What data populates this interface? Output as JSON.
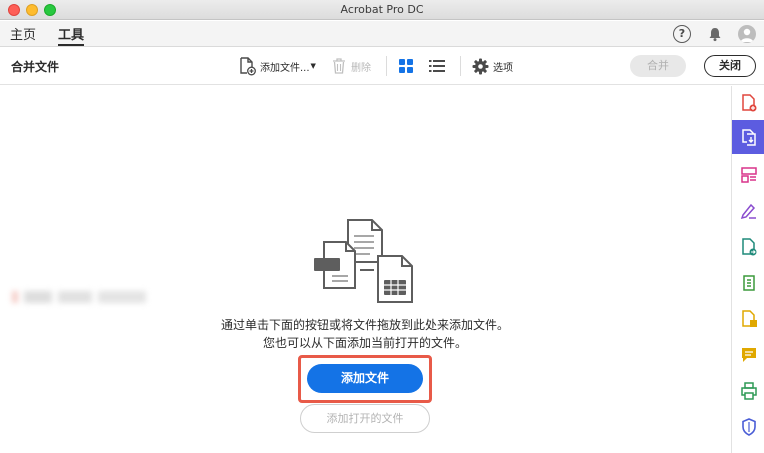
{
  "window": {
    "title": "Acrobat Pro DC"
  },
  "tabs": {
    "home": "主页",
    "tools": "工具"
  },
  "header_icons": {
    "help": "?"
  },
  "toolbar": {
    "title": "合并文件",
    "add_files": "添加文件...",
    "delete": "删除",
    "options": "选项",
    "merge": "合并",
    "close": "关闭"
  },
  "main": {
    "message_line1": "通过单击下面的按钮或将文件拖放到此处来添加文件。",
    "message_line2": "您也可以从下面添加当前打开的文件。",
    "add_files_button": "添加文件",
    "add_open_files_button": "添加打开的文件"
  },
  "right_rail": {
    "items": [
      "create-pdf-icon",
      "combine-files-icon",
      "organize-pages-icon",
      "fill-sign-icon",
      "export-pdf-icon",
      "compress-pdf-icon",
      "edit-pdf-icon",
      "comment-icon",
      "print-production-icon",
      "protect-icon"
    ],
    "active_index": 1
  },
  "colors": {
    "accent": "#1473e6",
    "highlight_border": "#e85a48",
    "rail_active": "#5c5ce0"
  }
}
